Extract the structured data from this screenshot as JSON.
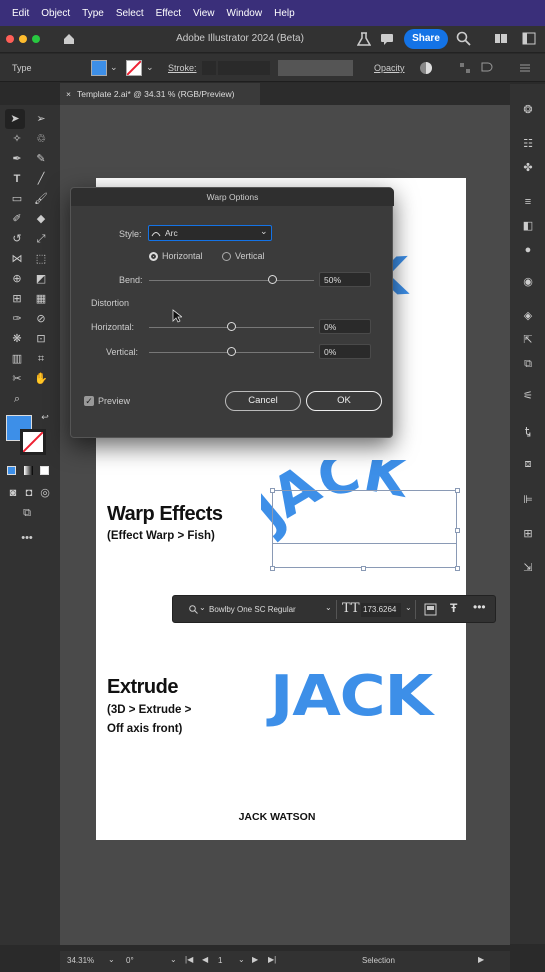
{
  "menu": [
    "Edit",
    "Object",
    "Type",
    "Select",
    "Effect",
    "View",
    "Window",
    "Help"
  ],
  "app": {
    "title": "Adobe Illustrator 2024 (Beta)",
    "share_label": "Share"
  },
  "control_bar": {
    "type_label": "Type",
    "stroke_label": "Stroke:",
    "opacity_label": "Opacity"
  },
  "document": {
    "tab_label": "Template 2.ai* @ 34.31 % (RGB/Preview)",
    "close_glyph": "×"
  },
  "dialog": {
    "title": "Warp Options",
    "style_label": "Style:",
    "style_value": "Arc",
    "horizontal_label": "Horizontal",
    "vertical_label": "Vertical",
    "bend_label": "Bend:",
    "bend_value": "50%",
    "distortion_label": "Distortion",
    "dist_horizontal_label": "Horizontal:",
    "dist_horizontal_value": "0%",
    "dist_vertical_label": "Vertical:",
    "dist_vertical_value": "0%",
    "preview_label": "Preview",
    "cancel_label": "Cancel",
    "ok_label": "OK",
    "bend_fraction": 0.75,
    "dist_h_fraction": 0.5,
    "dist_v_fraction": 0.5
  },
  "artboard": {
    "jack_text": "JACK",
    "warp_heading": "Warp Effects",
    "warp_sub": "(Effect Warp > Fish)",
    "extrude_heading": "Extrude",
    "extrude_sub1": "(3D > Extrude >",
    "extrude_sub2": "Off axis front)",
    "footer": "JACK WATSON"
  },
  "context_bar": {
    "font_name": "Bowlby One SC Regular",
    "font_size": "173.6264"
  },
  "status_bar": {
    "zoom": "34.31%",
    "rotation": "0°",
    "artboard_num": "1",
    "tool": "Selection"
  },
  "colors": {
    "accent_blue": "#3d8fe8",
    "share_blue": "#1473e6",
    "menubar": "#3a2f7a"
  }
}
